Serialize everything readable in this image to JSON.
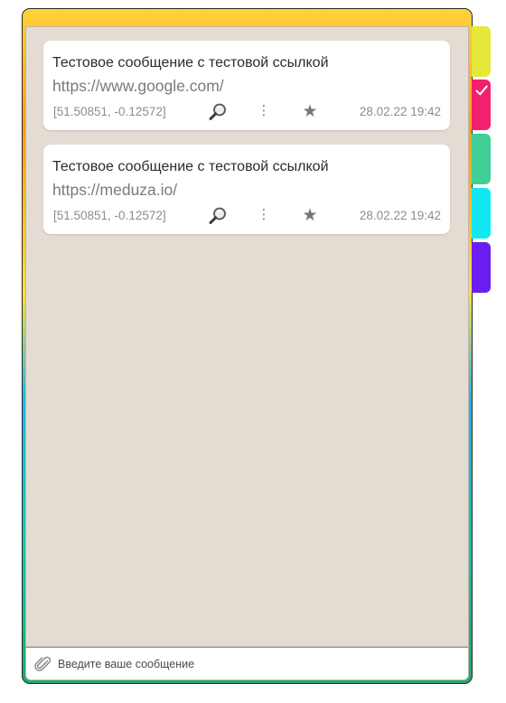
{
  "messages": [
    {
      "text": "Тестовое сообщение с тестовой ссылкой",
      "link": "https://www.google.com/",
      "coords": "[51.50851, -0.12572]",
      "timestamp": "28.02.22 19:42"
    },
    {
      "text": "Тестовое сообщение с тестовой ссылкой",
      "link": "https://meduza.io/",
      "coords": "[51.50851, -0.12572]",
      "timestamp": "28.02.22 19:42"
    }
  ],
  "input": {
    "placeholder": "Введите ваше сообщение",
    "value": ""
  },
  "color_tabs": [
    {
      "color": "#e5e83a",
      "selected": false
    },
    {
      "color": "#f2206e",
      "selected": true
    },
    {
      "color": "#3fcf97",
      "selected": false
    },
    {
      "color": "#12e8f3",
      "selected": false
    },
    {
      "color": "#6a1ff0",
      "selected": false
    }
  ],
  "icons": {
    "search": "magnifier-icon",
    "more": "more-vertical-icon",
    "star": "star-icon",
    "attach": "paperclip-icon",
    "check": "checkmark-icon"
  }
}
